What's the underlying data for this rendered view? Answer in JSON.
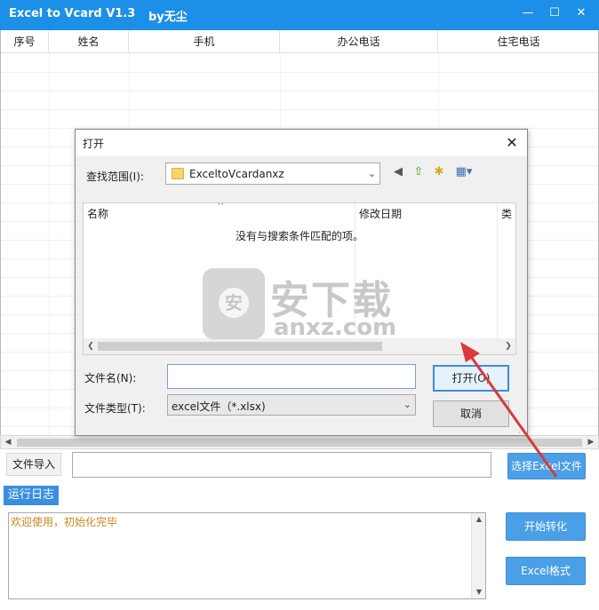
{
  "app": {
    "title": "Excel to Vcard V1.3",
    "author": "by无尘",
    "window_buttons": [
      "minimize-icon",
      "maximize-icon",
      "close-icon"
    ]
  },
  "grid": {
    "columns": [
      "序号",
      "姓名",
      "手机",
      "办公电话",
      "住宅电话"
    ]
  },
  "controls": {
    "file_import_label": "文件导入",
    "file_path_value": "",
    "select_excel_button": "选择Excel文件",
    "log_tab": "运行日志",
    "log_text": "欢迎使用，初始化完毕",
    "start_button": "开始转化",
    "format_button": "Excel格式"
  },
  "dialog": {
    "title": "打开",
    "look_in_label": "查找范围(I):",
    "look_in_value": "ExceltoVcardanxz",
    "list_headers": [
      "名称",
      "修改日期",
      "类"
    ],
    "empty_message": "没有与搜索条件匹配的项。",
    "filename_label": "文件名(N):",
    "filename_value": "",
    "filetype_label": "文件类型(T):",
    "filetype_value": "excel文件（*.xlsx)",
    "open_button": "打开(O)",
    "cancel_button": "取消",
    "toolbar_icons": [
      "back-icon",
      "up-folder-icon",
      "new-folder-icon",
      "view-menu-icon"
    ]
  },
  "watermark": {
    "cn": "安下载",
    "en": "anxz.com",
    "badge": "安"
  },
  "colors": {
    "titlebar": "#1c8fe6",
    "button_blue": "#4a9fe6",
    "log_text": "#c8871c",
    "arrow": "#d93a3a"
  }
}
